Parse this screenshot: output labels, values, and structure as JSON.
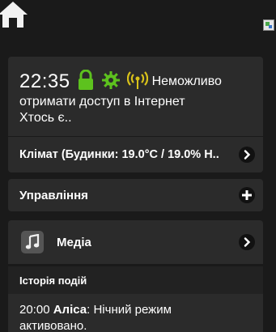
{
  "top": {
    "home_icon": "home-icon",
    "tile_icon": "app-tile-icon"
  },
  "status": {
    "time": "22:35",
    "icons": [
      "lock-icon",
      "gear-icon",
      "antenna-icon"
    ],
    "message_line1": "Неможливо",
    "message_line2": "отримати доступ в Інтернет",
    "message_line3": "Хтось є..",
    "climate": "Клімат (Будинки: 19.0°C / 19.0% Н..",
    "colors": {
      "green": "#5dc21e",
      "yellow": "#d9c21a"
    }
  },
  "control": {
    "label": "Управління"
  },
  "media": {
    "label": "Медіа",
    "icon": "music-note-icon"
  },
  "history": {
    "title": "Історія подій",
    "entries": [
      {
        "time": "20:00",
        "who": "Аліса",
        "text": ": Нічний режим",
        "text_cont": "активовано."
      }
    ]
  }
}
